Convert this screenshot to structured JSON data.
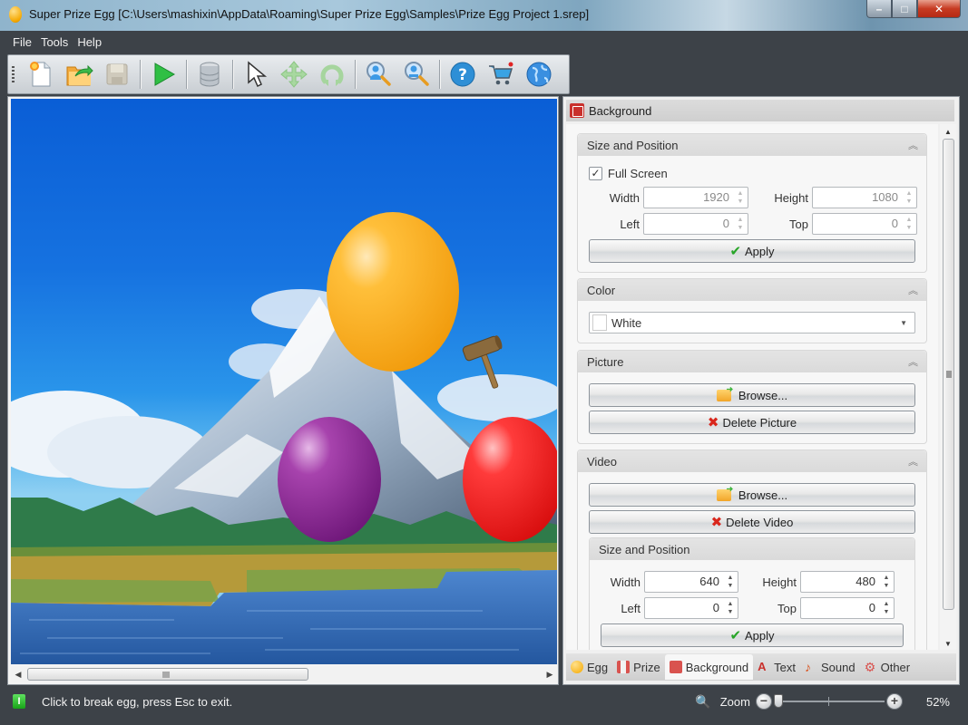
{
  "window": {
    "title": "Super Prize Egg [C:\\Users\\mashixin\\AppData\\Roaming\\Super Prize Egg\\Samples\\Prize Egg Project 1.srep]",
    "caption_buttons": {
      "minimize": "–",
      "maximize": "□",
      "close": "✕"
    }
  },
  "menu": [
    "File",
    "Tools",
    "Help"
  ],
  "toolbar": [
    {
      "name": "new-project",
      "icon": "new-document-icon",
      "enabled": true
    },
    {
      "name": "open-project",
      "icon": "open-folder-icon",
      "enabled": true
    },
    {
      "name": "save-project",
      "icon": "floppy-disk-icon",
      "enabled": false
    },
    {
      "name": "run",
      "icon": "play-icon",
      "enabled": true
    },
    {
      "name": "database",
      "icon": "database-icon",
      "enabled": true
    },
    {
      "name": "select",
      "icon": "pointer-icon",
      "enabled": true
    },
    {
      "name": "move",
      "icon": "move-arrows-icon",
      "enabled": false
    },
    {
      "name": "rotate",
      "icon": "rotate-icon",
      "enabled": false
    },
    {
      "name": "zoom-in",
      "icon": "zoom-in-icon",
      "enabled": true
    },
    {
      "name": "zoom-out",
      "icon": "zoom-out-icon",
      "enabled": true
    },
    {
      "name": "help",
      "icon": "help-icon",
      "enabled": true
    },
    {
      "name": "buy",
      "icon": "cart-icon",
      "enabled": true
    },
    {
      "name": "website",
      "icon": "globe-icon",
      "enabled": true
    }
  ],
  "canvas": {
    "eggs": [
      {
        "name": "orange-egg",
        "color": "#f8a81c"
      },
      {
        "name": "purple-egg",
        "color": "#8e2a92"
      },
      {
        "name": "red-egg",
        "color": "#ef1f1f"
      }
    ],
    "cursor": "hammer-icon"
  },
  "panel": {
    "title": "Background",
    "size_position": {
      "title": "Size and Position",
      "full_screen_label": "Full Screen",
      "full_screen_checked": true,
      "width_label": "Width",
      "width_value": "1920",
      "height_label": "Height",
      "height_value": "1080",
      "left_label": "Left",
      "left_value": "0",
      "top_label": "Top",
      "top_value": "0",
      "apply_label": "Apply"
    },
    "color": {
      "title": "Color",
      "value": "White",
      "swatch": "#ffffff"
    },
    "picture": {
      "title": "Picture",
      "browse_label": "Browse...",
      "delete_label": "Delete Picture"
    },
    "video": {
      "title": "Video",
      "browse_label": "Browse...",
      "delete_label": "Delete Video",
      "size_position": {
        "title": "Size and Position",
        "width_label": "Width",
        "width_value": "640",
        "height_label": "Height",
        "height_value": "480",
        "left_label": "Left",
        "left_value": "0",
        "top_label": "Top",
        "top_value": "0",
        "apply_label": "Apply"
      }
    },
    "collapse_glyph": "︽",
    "tabs": [
      {
        "label": "Egg",
        "active": false
      },
      {
        "label": "Prize",
        "active": false
      },
      {
        "label": "Background",
        "active": true
      },
      {
        "label": "Text",
        "active": false
      },
      {
        "label": "Sound",
        "active": false
      },
      {
        "label": "Other",
        "active": false
      }
    ]
  },
  "status": {
    "message": "Click to break egg, press Esc to exit.",
    "zoom_label": "Zoom",
    "zoom_percent": "52%",
    "zoom_value": 52
  }
}
